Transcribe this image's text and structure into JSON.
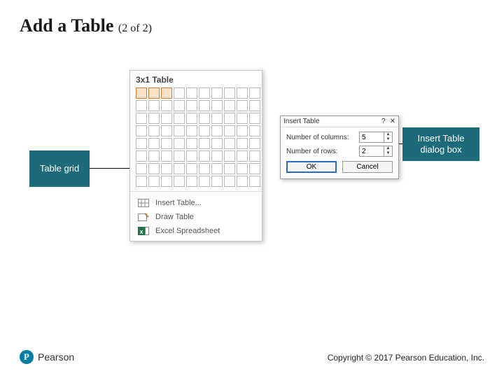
{
  "title": "Add a Table",
  "title_suffix": "(2 of 2)",
  "grid_panel": {
    "caption": "3x1 Table",
    "selected_cols": 3,
    "selected_rows": 1,
    "menu": {
      "insert_table": "Insert Table...",
      "draw_table": "Draw Table",
      "excel": "Excel Spreadsheet"
    }
  },
  "dialog": {
    "title": "Insert Table",
    "cols_label": "Number of columns:",
    "cols_value": "5",
    "rows_label": "Number of rows:",
    "rows_value": "2",
    "ok": "OK",
    "cancel": "Cancel"
  },
  "callouts": {
    "table_grid": "Table grid",
    "dialog_box": "Insert Table dialog box"
  },
  "footer": {
    "brand": "Pearson",
    "copyright": "Copyright © 2017 Pearson Education, Inc."
  }
}
